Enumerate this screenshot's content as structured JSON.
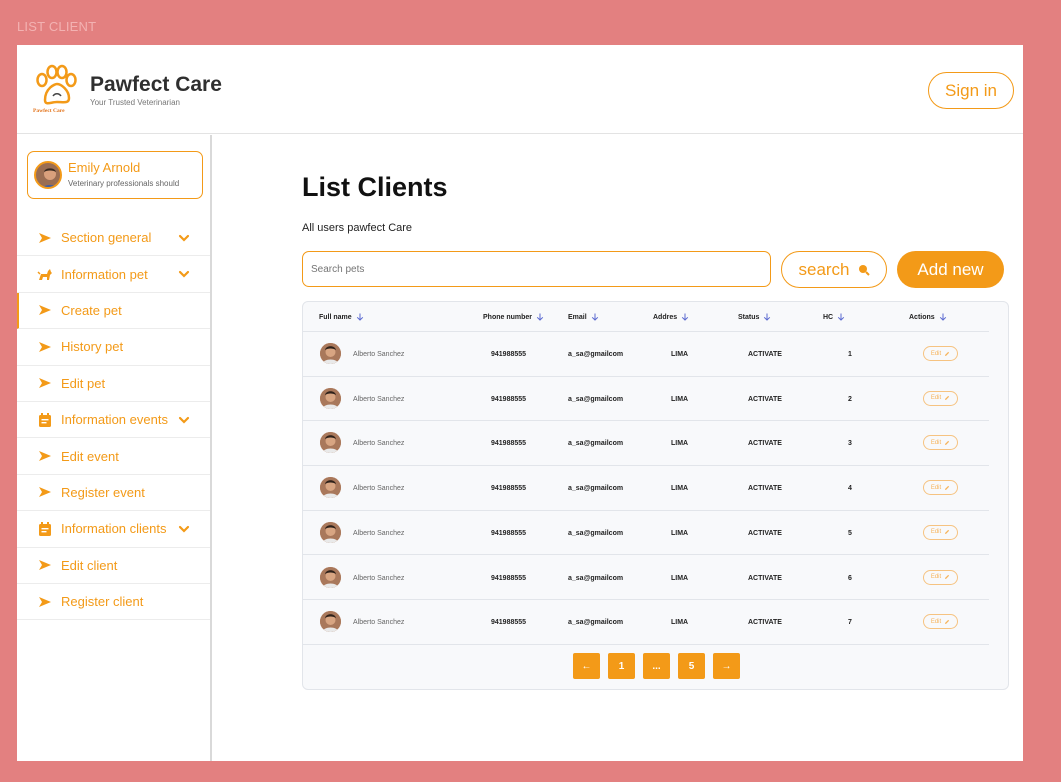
{
  "frame_label": "LIST CLIENT",
  "header": {
    "brand_title": "Pawfect Care",
    "brand_subtitle": "Your Trusted Veterinarian",
    "logo_text": "Pawfect Care",
    "sign_in": "Sign in"
  },
  "colors": {
    "accent": "#f39a18",
    "background": "#e38080"
  },
  "profile": {
    "name": "Emily Arnold",
    "description": "Veterinary professionals should"
  },
  "sidebar": {
    "items": [
      {
        "label": "Section general",
        "icon": "chevron-right-icon",
        "expandable": true
      },
      {
        "label": "Information pet",
        "icon": "dog-icon",
        "expandable": true
      },
      {
        "label": "Create pet",
        "icon": "chevron-right-icon",
        "expandable": false,
        "active": true
      },
      {
        "label": "History pet",
        "icon": "chevron-right-icon",
        "expandable": false
      },
      {
        "label": "Edit pet",
        "icon": "chevron-right-icon",
        "expandable": false
      },
      {
        "label": "Information events",
        "icon": "calendar-icon",
        "expandable": true
      },
      {
        "label": "Edit event",
        "icon": "chevron-right-icon",
        "expandable": false
      },
      {
        "label": "Register event",
        "icon": "chevron-right-icon",
        "expandable": false
      },
      {
        "label": "Information clients",
        "icon": "calendar-icon",
        "expandable": true
      },
      {
        "label": "Edit client",
        "icon": "chevron-right-icon",
        "expandable": false
      },
      {
        "label": "Register client",
        "icon": "chevron-right-icon",
        "expandable": false
      }
    ]
  },
  "main": {
    "title": "List Clients",
    "subtitle": "All users pawfect Care",
    "search_placeholder": "Search pets",
    "search_button": "search",
    "add_button": "Add  new"
  },
  "table": {
    "columns": [
      "Full name",
      "Phone number",
      "Email",
      "Addres",
      "Status",
      "HC",
      "Actions"
    ],
    "rows": [
      {
        "name": "Alberto Sanchez",
        "phone": "941988555",
        "email": "a_sa@gmailcom",
        "address": "LIMA",
        "status": "ACTIVATE",
        "hc": "1",
        "action": "Edit"
      },
      {
        "name": "Alberto Sanchez",
        "phone": "941988555",
        "email": "a_sa@gmailcom",
        "address": "LIMA",
        "status": "ACTIVATE",
        "hc": "2",
        "action": "Edit"
      },
      {
        "name": "Alberto Sanchez",
        "phone": "941988555",
        "email": "a_sa@gmailcom",
        "address": "LIMA",
        "status": "ACTIVATE",
        "hc": "3",
        "action": "Edit"
      },
      {
        "name": "Alberto Sanchez",
        "phone": "941988555",
        "email": "a_sa@gmailcom",
        "address": "LIMA",
        "status": "ACTIVATE",
        "hc": "4",
        "action": "Edit"
      },
      {
        "name": "Alberto Sanchez",
        "phone": "941988555",
        "email": "a_sa@gmailcom",
        "address": "LIMA",
        "status": "ACTIVATE",
        "hc": "5",
        "action": "Edit"
      },
      {
        "name": "Alberto Sanchez",
        "phone": "941988555",
        "email": "a_sa@gmailcom",
        "address": "LIMA",
        "status": "ACTIVATE",
        "hc": "6",
        "action": "Edit"
      },
      {
        "name": "Alberto Sanchez",
        "phone": "941988555",
        "email": "a_sa@gmailcom",
        "address": "LIMA",
        "status": "ACTIVATE",
        "hc": "7",
        "action": "Edit"
      }
    ]
  },
  "pagination": {
    "prev": "←",
    "pages": [
      "1",
      "...",
      "5"
    ],
    "next": "→"
  }
}
